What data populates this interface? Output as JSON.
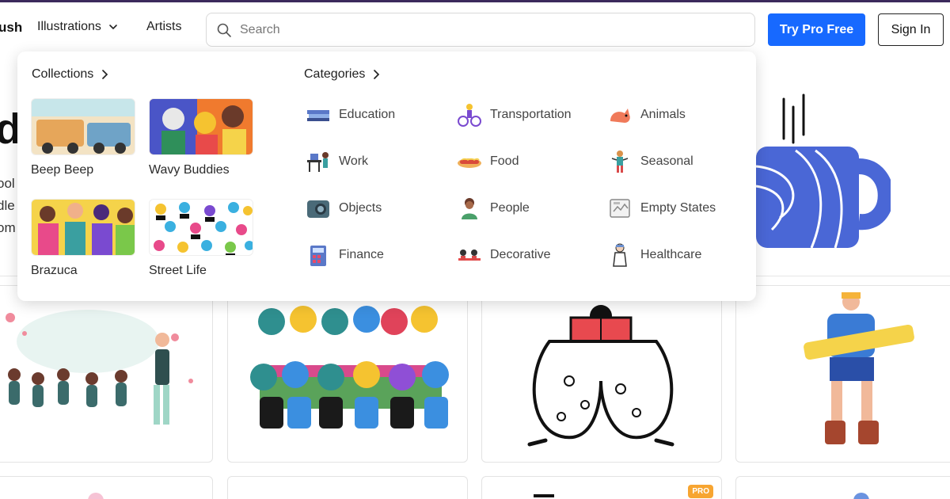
{
  "header": {
    "logo_fragment": "ush",
    "nav": {
      "illustrations": "Illustrations",
      "artists": "Artists"
    },
    "search_placeholder": "Search",
    "try_pro": "Try Pro Free",
    "sign_in": "Sign In"
  },
  "hero": {
    "letter": "d",
    "fragments": [
      "ool",
      "dle",
      "om"
    ]
  },
  "menu": {
    "collections_label": "Collections",
    "categories_label": "Categories",
    "collections": [
      {
        "label": "Beep Beep"
      },
      {
        "label": "Wavy Buddies"
      },
      {
        "label": "Brazuca"
      },
      {
        "label": "Street Life"
      }
    ],
    "categories": [
      {
        "label": "Education",
        "icon": "education-icon"
      },
      {
        "label": "Transportation",
        "icon": "transportation-icon"
      },
      {
        "label": "Animals",
        "icon": "animals-icon"
      },
      {
        "label": "Work",
        "icon": "work-icon"
      },
      {
        "label": "Food",
        "icon": "food-icon"
      },
      {
        "label": "Seasonal",
        "icon": "seasonal-icon"
      },
      {
        "label": "Objects",
        "icon": "objects-icon"
      },
      {
        "label": "People",
        "icon": "people-icon"
      },
      {
        "label": "Empty States",
        "icon": "empty-states-icon"
      },
      {
        "label": "Finance",
        "icon": "finance-icon"
      },
      {
        "label": "Decorative",
        "icon": "decorative-icon"
      },
      {
        "label": "Healthcare",
        "icon": "healthcare-icon"
      }
    ]
  },
  "cards": {
    "pro_badge": "PRO"
  },
  "colors": {
    "primary": "#1769ff",
    "accent_top": "#3b2a5c",
    "mug_blue": "#4a67d6",
    "pro_orange": "#f7a531"
  }
}
